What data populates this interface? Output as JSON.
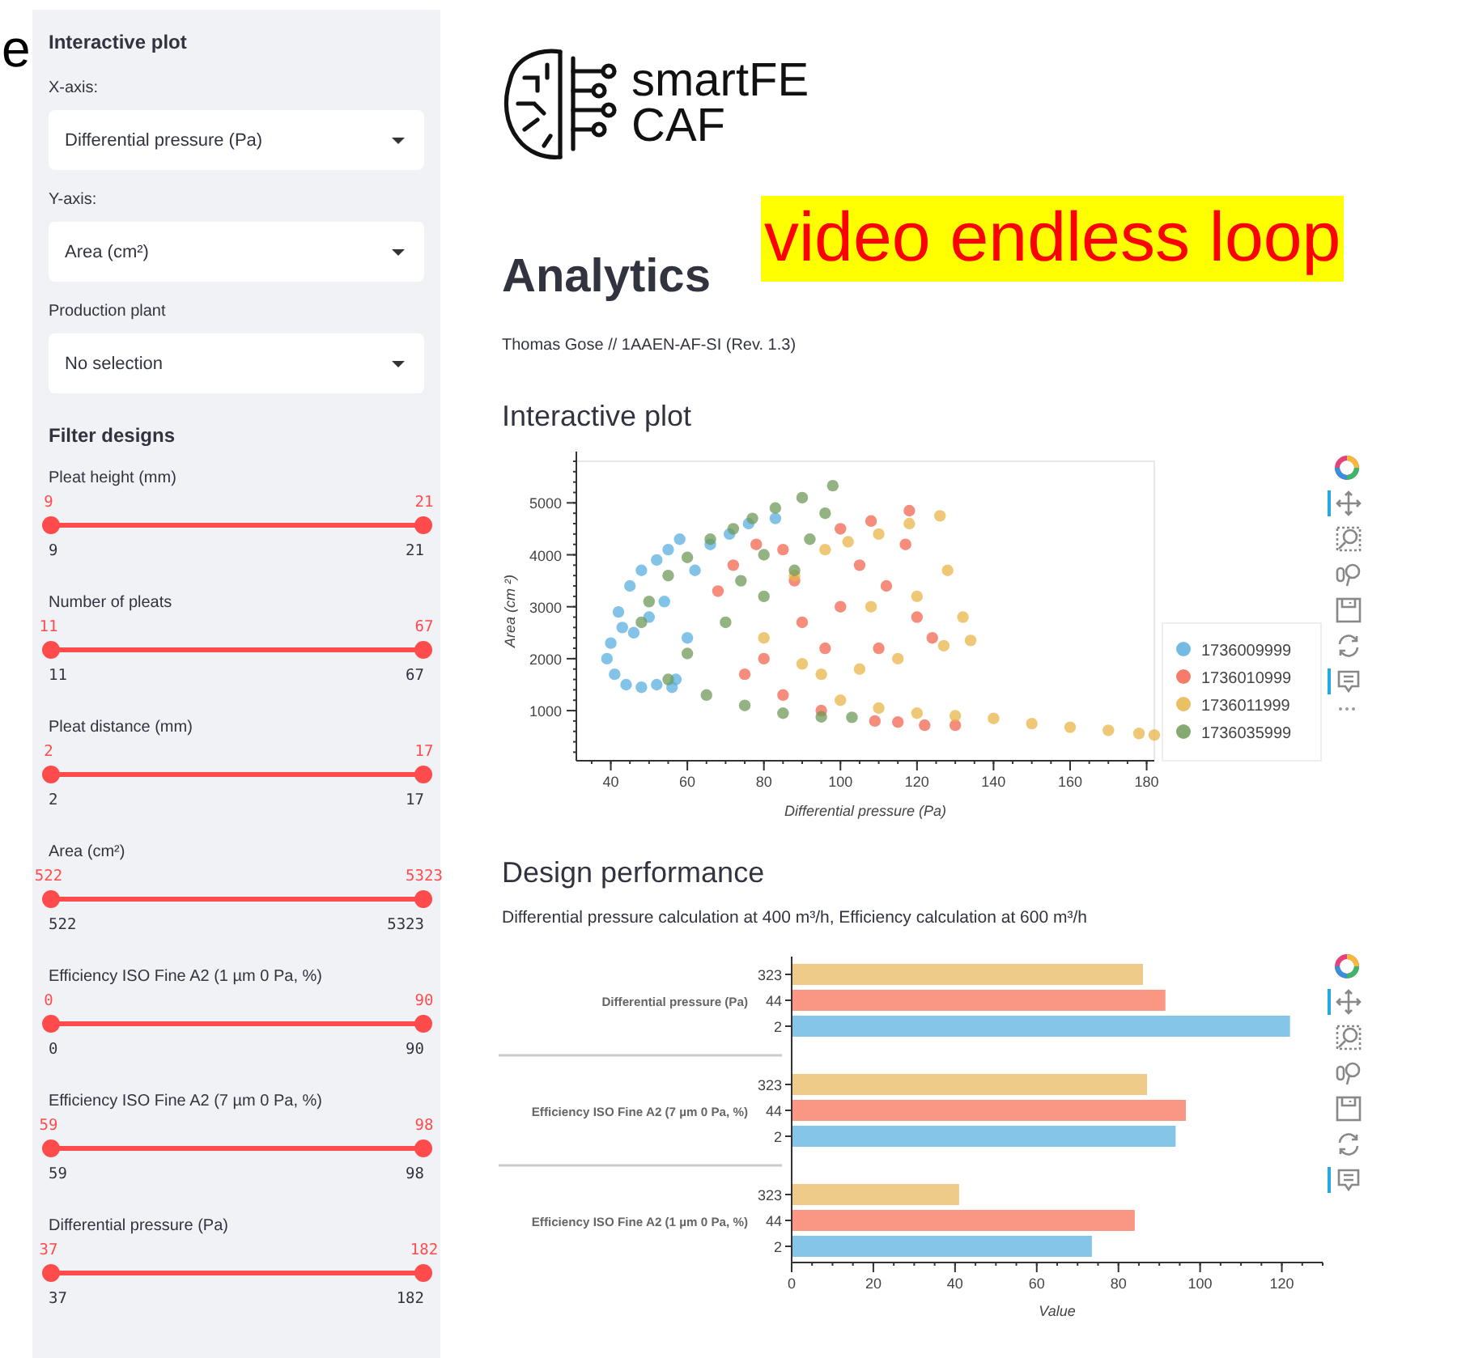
{
  "edge_text": "e",
  "sidebar": {
    "title": "Interactive plot",
    "selects": [
      {
        "label": "X-axis:",
        "value": "Differential pressure (Pa)"
      },
      {
        "label": "Y-axis:",
        "value": "Area (cm²)"
      },
      {
        "label": "Production plant",
        "value": "No selection"
      }
    ],
    "filter_title": "Filter designs",
    "sliders": [
      {
        "label": "Pleat height (mm)",
        "low": "9",
        "high": "21",
        "min": "9",
        "max": "21"
      },
      {
        "label": "Number of pleats",
        "low": "11",
        "high": "67",
        "min": "11",
        "max": "67"
      },
      {
        "label": "Pleat distance (mm)",
        "low": "2",
        "high": "17",
        "min": "2",
        "max": "17"
      },
      {
        "label": "Area (cm²)",
        "low": "522",
        "high": "5323",
        "min": "522",
        "max": "5323"
      },
      {
        "label": "Efficiency ISO Fine A2 (1 µm 0 Pa, %)",
        "low": "0",
        "high": "90",
        "min": "0",
        "max": "90"
      },
      {
        "label": "Efficiency ISO Fine A2 (7 µm 0 Pa, %)",
        "low": "59",
        "high": "98",
        "min": "59",
        "max": "98"
      },
      {
        "label": "Differential pressure (Pa)",
        "low": "37",
        "high": "182",
        "min": "37",
        "max": "182"
      }
    ]
  },
  "logo": {
    "line1": "smartFE",
    "line2": "CAF"
  },
  "overlay_note": "video endless loop",
  "title": "Analytics",
  "subtitle": "Thomas Gose // 1AAEN-AF-SI (Rev. 1.3)",
  "interactive_plot": {
    "heading": "Interactive plot",
    "toolbar": [
      {
        "kind": "logo"
      },
      {
        "kind": "pan",
        "active": true
      },
      {
        "kind": "box-zoom",
        "active": false
      },
      {
        "kind": "wheel-zoom",
        "active": false
      },
      {
        "kind": "save",
        "active": false
      },
      {
        "kind": "reset",
        "active": false
      },
      {
        "kind": "hover",
        "active": true
      },
      {
        "kind": "more"
      }
    ],
    "chart_data": {
      "type": "scatter",
      "xlabel": "Differential pressure (Pa)",
      "ylabel": "Area (cm ²)",
      "xlim": [
        31,
        182
      ],
      "ylim": [
        35,
        5800
      ],
      "xticks": [
        40,
        60,
        80,
        100,
        120,
        140,
        160,
        180
      ],
      "yticks": [
        1000,
        2000,
        3000,
        4000,
        5000
      ],
      "series": [
        {
          "name": "1736009999",
          "color": "#5aafe0",
          "x": [
            40,
            42,
            45,
            48,
            52,
            55,
            58,
            39,
            41,
            44,
            48,
            52,
            56,
            46,
            50,
            54,
            43,
            57,
            62,
            66,
            71,
            76,
            83,
            60
          ],
          "values": [
            2300,
            2900,
            3400,
            3700,
            3900,
            4100,
            4300,
            2000,
            1700,
            1500,
            1450,
            1500,
            1450,
            2500,
            2800,
            3100,
            2600,
            1600,
            3700,
            4200,
            4400,
            4600,
            4700,
            2400
          ]
        },
        {
          "name": "1736010999",
          "color": "#f3654f",
          "x": [
            68,
            72,
            78,
            85,
            100,
            108,
            118,
            112,
            120,
            124,
            100,
            90,
            80,
            75,
            85,
            95,
            109,
            115,
            122,
            130,
            110,
            96,
            88,
            105,
            117
          ],
          "values": [
            3300,
            3800,
            4200,
            4100,
            4500,
            4650,
            4850,
            3400,
            2800,
            2400,
            3000,
            2700,
            2000,
            1700,
            1300,
            1000,
            800,
            780,
            720,
            720,
            2200,
            2200,
            3500,
            3800,
            4200
          ]
        },
        {
          "name": "1736011999",
          "color": "#e8b54a",
          "x": [
            80,
            88,
            96,
            102,
            110,
            118,
            126,
            128,
            132,
            134,
            127,
            115,
            105,
            95,
            100,
            110,
            120,
            130,
            140,
            150,
            160,
            170,
            178,
            182,
            90,
            108,
            120
          ],
          "values": [
            2400,
            3600,
            4100,
            4250,
            4400,
            4600,
            4750,
            3700,
            2800,
            2350,
            2250,
            2000,
            1800,
            1700,
            1200,
            1050,
            950,
            900,
            850,
            750,
            680,
            620,
            560,
            530,
            1900,
            3000,
            3200
          ]
        },
        {
          "name": "1736035999",
          "color": "#6f9a58",
          "x": [
            48,
            50,
            55,
            60,
            66,
            72,
            77,
            83,
            90,
            98,
            96,
            92,
            88,
            80,
            70,
            60,
            55,
            65,
            75,
            85,
            95,
            103,
            80,
            74
          ],
          "values": [
            2700,
            3100,
            3600,
            3950,
            4300,
            4500,
            4700,
            4900,
            5100,
            5330,
            4800,
            4300,
            3700,
            3200,
            2700,
            2100,
            1600,
            1300,
            1100,
            950,
            880,
            870,
            4000,
            3500
          ]
        }
      ],
      "legend": "right"
    }
  },
  "design_performance": {
    "heading": "Design performance",
    "caption": "Differential pressure calculation at 400 m³/h, Efficiency calculation at 600 m³/h",
    "toolbar": [
      {
        "kind": "logo"
      },
      {
        "kind": "pan",
        "active": true
      },
      {
        "kind": "box-zoom",
        "active": false
      },
      {
        "kind": "wheel-zoom",
        "active": false
      },
      {
        "kind": "save",
        "active": false
      },
      {
        "kind": "reset",
        "active": false
      },
      {
        "kind": "hover",
        "active": true
      }
    ],
    "chart_data": {
      "type": "bar",
      "orientation": "horizontal",
      "xlabel": "Value",
      "xlim": [
        0,
        130
      ],
      "xticks": [
        0,
        20,
        40,
        60,
        80,
        100,
        120
      ],
      "categories": [
        "Differential pressure (Pa)",
        "Efficiency ISO Fine A2 (7 µm  0 Pa, %)",
        "Efficiency ISO Fine A2 (1 µm  0 Pa, %)"
      ],
      "series": [
        {
          "name": "323",
          "color": "#efcb8a",
          "values": [
            86,
            87,
            41
          ]
        },
        {
          "name": "44",
          "color": "#fa9684",
          "values": [
            91.5,
            96.5,
            84
          ]
        },
        {
          "name": "2",
          "color": "#85c6e8",
          "values": [
            122,
            94,
            73.5
          ]
        }
      ]
    }
  }
}
